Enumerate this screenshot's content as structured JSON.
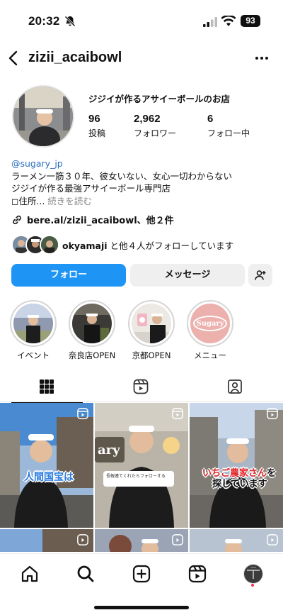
{
  "status_bar": {
    "time": "20:32",
    "battery": "93",
    "icons": [
      "bell-slash-icon",
      "signal-icon",
      "wifi-icon",
      "battery-icon"
    ]
  },
  "header": {
    "username": "zizii_acaibowl",
    "back_icon": "chevron-left-icon",
    "more_icon": "ellipsis-icon"
  },
  "profile": {
    "display_name": "ジジイが作るアサイーボールのお店",
    "stats": [
      {
        "value": "96",
        "label": "投稿"
      },
      {
        "value": "2,962",
        "label": "フォロワー"
      },
      {
        "value": "6",
        "label": "フォロー中"
      }
    ]
  },
  "bio": {
    "handle": "@sugary_jp",
    "line1": "ラーメン一筋３０年、彼女いない、女心一切わからない",
    "line2": "ジジイが作る最強アサイーボール専門店",
    "line3": "◻︎住所...",
    "more": "続きを読む",
    "link": "bere.al/zizii_acaibowl、他２件",
    "followed_by_name": "okyamaji",
    "followed_by_rest": "と他４人がフォローしています"
  },
  "buttons": {
    "follow": "フォロー",
    "message": "メッセージ",
    "add_user_icon": "person-add-icon"
  },
  "highlights": [
    {
      "label": "イベント"
    },
    {
      "label": "奈良店OPEN"
    },
    {
      "label": "京都OPEN"
    },
    {
      "label": "メニュー",
      "badge": "Sugary"
    }
  ],
  "tabs": [
    {
      "name": "grid",
      "icon": "grid-icon",
      "active": true
    },
    {
      "name": "reels",
      "icon": "reels-icon",
      "active": false
    },
    {
      "name": "tagged",
      "icon": "tagged-icon",
      "active": false
    }
  ],
  "posts": {
    "post1_caption": "人間国宝は",
    "post2_sign": "ary",
    "post2_note": "長報連てくれたらフォローする",
    "post3_caption_red": "いちご農家さん",
    "post3_caption_tail": "を",
    "post3_caption_line2": "探しています"
  },
  "bottom_nav": [
    "home-icon",
    "search-icon",
    "create-icon",
    "reels-icon",
    "profile-avatar"
  ],
  "colors": {
    "follow_blue": "#1e95f5",
    "link_blue": "#2a6fbe",
    "caption_blue": "#2a7be0",
    "caption_red": "#e3262a",
    "secondary_button": "#efefef"
  }
}
